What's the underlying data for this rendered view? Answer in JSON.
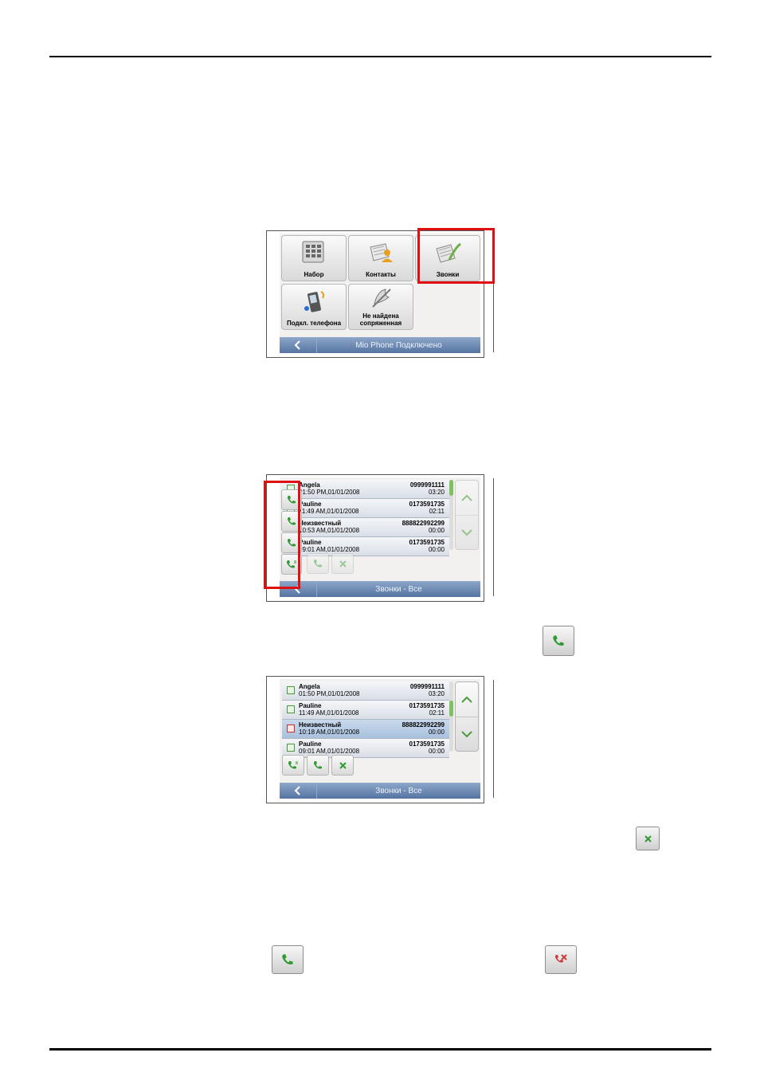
{
  "figure1": {
    "tiles": [
      {
        "label": "Набор"
      },
      {
        "label": "Контакты"
      },
      {
        "label": "Звонки"
      },
      {
        "label": "Подкл. телефона"
      },
      {
        "label": "Не найдена сопряженная"
      }
    ],
    "status_title": "Mio Phone Подключено"
  },
  "figure2": {
    "calls": [
      {
        "name": "Angela",
        "time": "01:50 PM,01/01/2008",
        "number": "0999991111",
        "duration": "03:20"
      },
      {
        "name": "Pauline",
        "time": "11:49 AM,01/01/2008",
        "number": "0173591735",
        "duration": "02:11"
      },
      {
        "name": "Неизвестный",
        "time": "10:53 AM,01/01/2008",
        "number": "888822992299",
        "duration": "00:00"
      },
      {
        "name": "Pauline",
        "time": "09:01 AM,01/01/2008",
        "number": "0173591735",
        "duration": "00:00"
      }
    ],
    "status_title": "Звонки - Все"
  },
  "figure3": {
    "calls": [
      {
        "name": "Angela",
        "time": "01:50 PM,01/01/2008",
        "number": "0999991111",
        "duration": "03:20"
      },
      {
        "name": "Pauline",
        "time": "11:49 AM,01/01/2008",
        "number": "0173591735",
        "duration": "02:11"
      },
      {
        "name": "Неизвестный",
        "time": "10:18 AM,01/01/2008",
        "number": "888822992299",
        "duration": "00:00"
      },
      {
        "name": "Pauline",
        "time": "09:01 AM,01/01/2008",
        "number": "0173591735",
        "duration": "00:00"
      }
    ],
    "status_title": "Звонки - Все"
  },
  "colors": {
    "highlight": "#e01010",
    "status_bar": "#5574a2",
    "call_green": "#2f9a2f",
    "hangup_red": "#d03a3a"
  }
}
